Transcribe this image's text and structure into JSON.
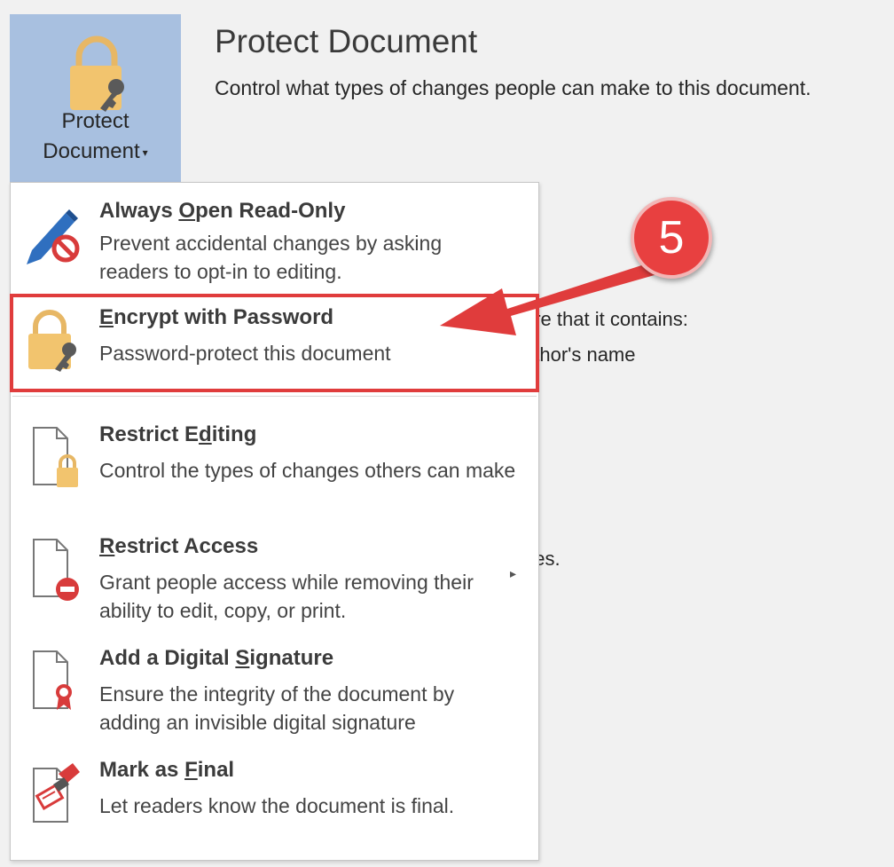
{
  "ribbon": {
    "protect_button": {
      "line1": "Protect",
      "line2": "Document",
      "caret": "▾"
    }
  },
  "header": {
    "title": "Protect Document",
    "description": "Control what types of changes people can make to this document."
  },
  "background_text": {
    "line1": "are that it contains:",
    "line2": "uthor's name",
    "line3": "ges."
  },
  "menu": {
    "items": [
      {
        "id": "always-open-read-only",
        "title_pre": "Always ",
        "title_u": "O",
        "title_post": "pen Read-Only",
        "desc": "Prevent accidental changes by asking readers to opt-in to editing.",
        "icon": "pen-no-icon"
      },
      {
        "id": "encrypt-with-password",
        "title_pre": "",
        "title_u": "E",
        "title_post": "ncrypt with Password",
        "desc": "Password-protect this document",
        "icon": "lock-key-icon"
      },
      {
        "id": "restrict-editing",
        "title_pre": "Restrict E",
        "title_u": "d",
        "title_post": "iting",
        "desc": "Control the types of changes others can make",
        "icon": "doc-lock-icon"
      },
      {
        "id": "restrict-access",
        "title_pre": "",
        "title_u": "R",
        "title_post": "estrict Access",
        "desc": "Grant people access while removing their ability to edit, copy, or print.",
        "icon": "doc-block-icon",
        "submenu": "▸"
      },
      {
        "id": "add-digital-signature",
        "title_pre": "Add a Digital ",
        "title_u": "S",
        "title_post": "ignature",
        "desc": "Ensure the integrity of the document by adding an invisible digital signature",
        "icon": "doc-ribbon-icon"
      },
      {
        "id": "mark-as-final",
        "title_pre": "Mark as ",
        "title_u": "F",
        "title_post": "inal",
        "desc": "Let readers know the document is final.",
        "icon": "stamp-icon"
      }
    ]
  },
  "annotation": {
    "step_number": "5",
    "color": "#e03c3c"
  }
}
